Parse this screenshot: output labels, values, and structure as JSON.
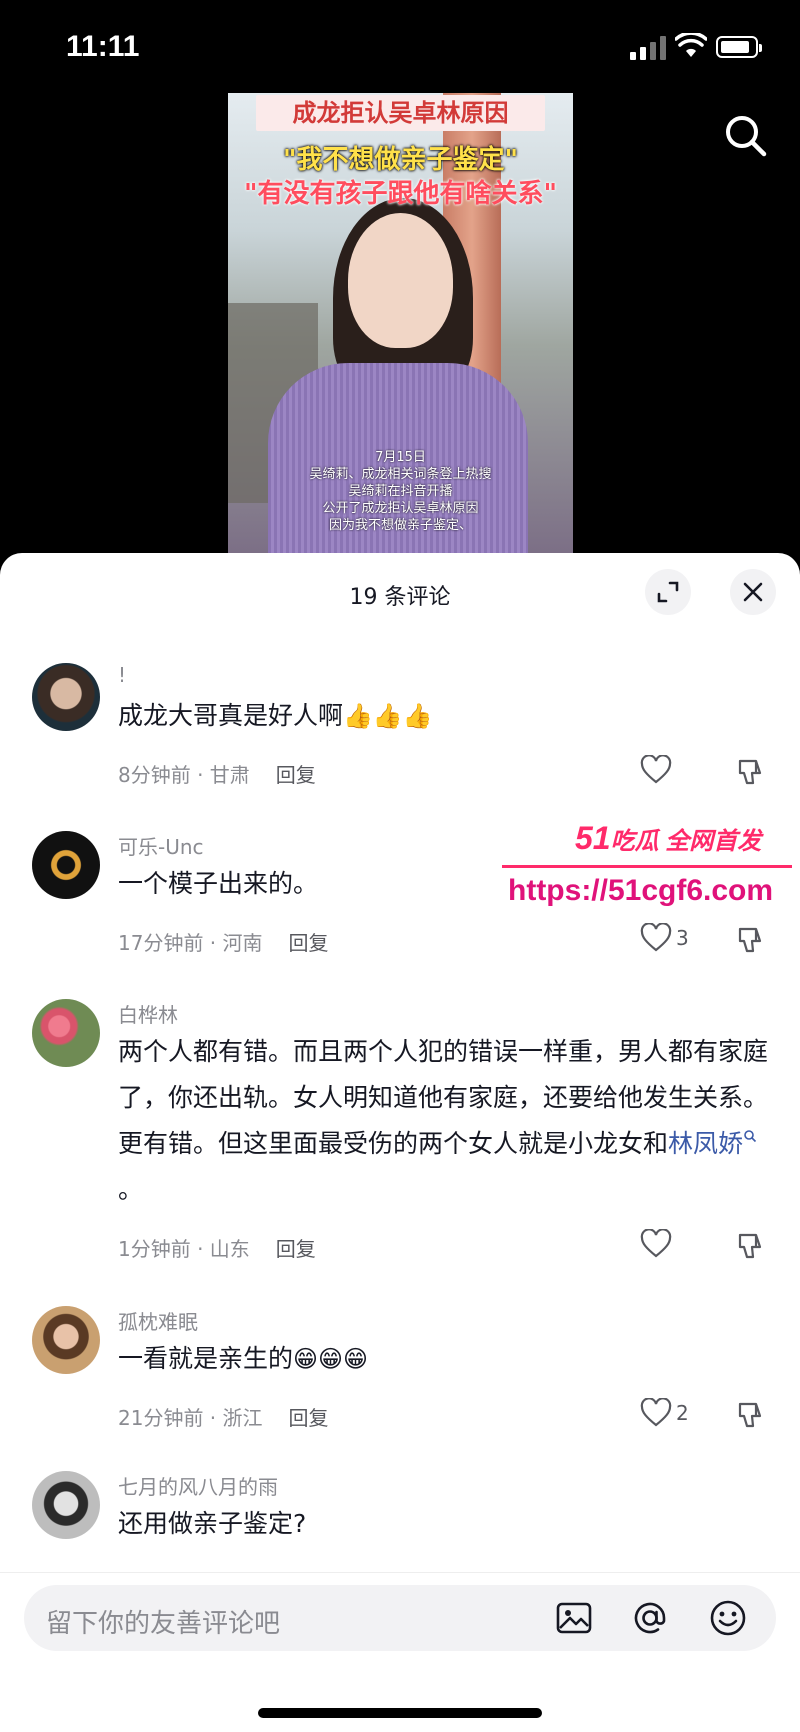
{
  "status_bar": {
    "time": "11:11"
  },
  "video": {
    "banner": "成龙拒认吴卓林原因",
    "line1": "\"我不想做亲子鉴定\"",
    "line2": "\"有没有孩子跟他有啥关系\"",
    "subtitle_lines": [
      "7月15日",
      "吴绮莉、成龙相关词条登上热搜",
      "吴绮莉在抖音开播",
      "公开了成龙拒认吴卓林原因",
      "因为我不想做亲子鉴定、"
    ]
  },
  "sheet": {
    "title": "19 条评论"
  },
  "comments": [
    {
      "user": "!",
      "text": "成龙大哥真是好人啊",
      "emoji": "👍👍👍",
      "time": "8分钟前 · 甘肃",
      "reply": "回复",
      "likes": ""
    },
    {
      "user": "可乐-Unc",
      "text": "一个模子出来的。",
      "emoji": "",
      "time": "17分钟前 · 河南",
      "reply": "回复",
      "likes": "3"
    },
    {
      "user": "白桦林",
      "text": "两个人都有错。而且两个人犯的错误一样重，男人都有家庭了，你还出轨。女人明知道他有家庭，还要给他发生关系。更有错。但这里面最受伤的两个女人就是小龙女和",
      "link": "林凤娇",
      "text_end": "。",
      "time": "1分钟前 · 山东",
      "reply": "回复",
      "likes": ""
    },
    {
      "user": "孤枕难眠",
      "text": "一看就是亲生的",
      "emoji": "😁😁😁",
      "time": "21分钟前 · 浙江",
      "reply": "回复",
      "likes": "2"
    },
    {
      "user": "七月的风八月的雨",
      "text": "还用做亲子鉴定?",
      "emoji": "",
      "time": "",
      "reply": "",
      "likes": ""
    }
  ],
  "watermark": {
    "brand": "51",
    "tag": "吃瓜 全网首发",
    "url": "https://51cgf6.com"
  },
  "input": {
    "placeholder": "留下你的友善评论吧"
  },
  "icons": [
    "search-icon",
    "expand-icon",
    "close-icon",
    "heart-icon",
    "dislike-icon",
    "image-icon",
    "at-icon",
    "emoji-icon"
  ]
}
